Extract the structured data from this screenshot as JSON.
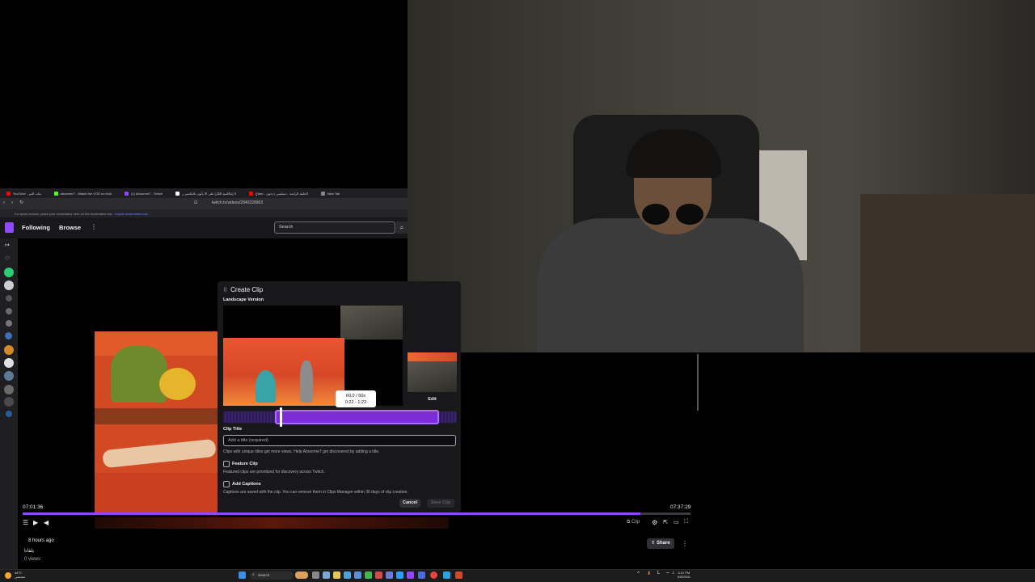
{
  "browser": {
    "tabs": [
      {
        "label": "YouTube - بثاث النتر",
        "color": "#ff0000"
      },
      {
        "label": "aboorme7 - Watch the VOD on Kick",
        "color": "#53fc18"
      },
      {
        "label": "(1) Aboorme7 - Twitch",
        "color": "#9147ff"
      },
      {
        "label": "مااكتبيه الكل] على الا يأبون بالتكسير ر] X",
        "color": "#ffffff"
      },
      {
        "label": "ٍٍٍFahe - الحلقة الرابعة - دسلسي | دحون",
        "color": "#ff0000"
      },
      {
        "label": "New Tab",
        "color": "#888888"
      }
    ],
    "url": "twitch.tv/videos/2840328963",
    "bookmark_text": "For quick access, place your bookmarks here on the bookmarks bar.",
    "bookmark_link": "Import bookmarks now..."
  },
  "nav": {
    "following": "Following",
    "browse": "Browse",
    "more": "⋮",
    "search_placeholder": "Search",
    "search_icon": "magnifier-icon"
  },
  "clip_modal": {
    "title": "Create Clip",
    "subtitle": "Landscape Version",
    "tooltip_line1": "60.0 / 60s",
    "tooltip_line2": "0:22 - 1:22",
    "edit_label": "Edit",
    "clip_title_label": "Clip Title",
    "title_placeholder": "Add a title (required)",
    "title_help": "Clips with unique titles get more views. Help Aboorme7 get discovered by adding a title.",
    "feature_label": "Feature Clip",
    "feature_help": "Featured clips are prioritized for discovery across Twitch.",
    "captions_label": "Add Captions",
    "captions_help": "Captions are saved with the clip. You can remove them in Clips Manager within 30 days of clip creation.",
    "cancel_label": "Cancel",
    "save_label": "Save Clip"
  },
  "player": {
    "time_current": "07:01:36",
    "time_total": "07:37:29",
    "progress_fraction": 0.925,
    "clip_label": "Clip"
  },
  "video_info": {
    "age": "8 hours ago",
    "title": "يلفانا",
    "views": "0 views",
    "share_label": "Share"
  },
  "taskbar": {
    "weather_temp": "44°C",
    "weather_desc": "مشمس",
    "search_label": "Search",
    "time": "3:12 PM",
    "date": "8/8/2026"
  },
  "colors": {
    "twitch_purple": "#9147ff",
    "clip_selection": "#7d2dd6"
  }
}
